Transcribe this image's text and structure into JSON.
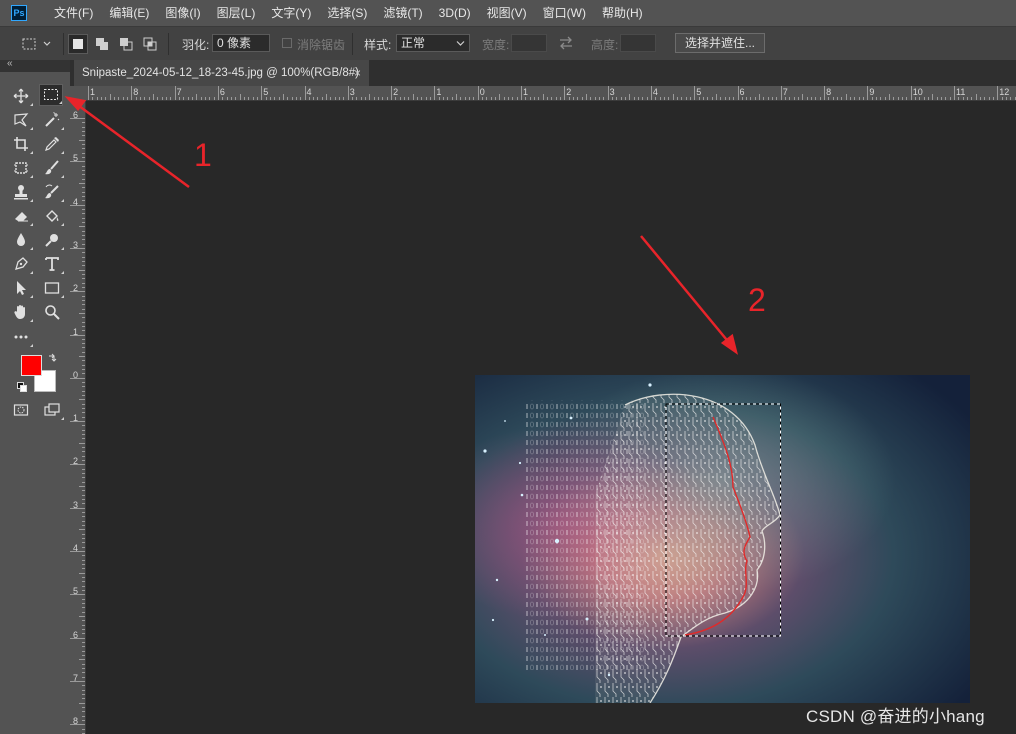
{
  "app": {
    "logo_text": "Ps"
  },
  "menu": [
    "文件(F)",
    "编辑(E)",
    "图像(I)",
    "图层(L)",
    "文字(Y)",
    "选择(S)",
    "滤镜(T)",
    "3D(D)",
    "视图(V)",
    "窗口(W)",
    "帮助(H)"
  ],
  "options_bar": {
    "feather_label": "羽化:",
    "feather_value": "0 像素",
    "antialias_label": "消除锯齿",
    "style_label": "样式:",
    "style_value": "正常",
    "width_label": "宽度:",
    "height_label": "高度:",
    "refine_button": "选择并遮住..."
  },
  "document": {
    "tab_title": "Snipaste_2024-05-12_18-23-45.jpg @ 100%(RGB/8#)",
    "close_glyph": "×"
  },
  "rulers": {
    "h_labels": [
      "1",
      "8",
      "7",
      "6",
      "5",
      "4",
      "3",
      "2",
      "1",
      "0",
      "1",
      "2",
      "3",
      "4",
      "5",
      "6",
      "7",
      "8",
      "9",
      "10",
      "11",
      "12"
    ],
    "v_labels": [
      "6",
      "5",
      "4",
      "3",
      "2",
      "1",
      "0",
      "1",
      "2",
      "3",
      "4",
      "5",
      "6",
      "7",
      "8"
    ]
  },
  "colors": {
    "foreground": "#ff0000",
    "background": "#ffffff",
    "annotation": "#e8242a"
  },
  "annotations": {
    "label_1": "1",
    "label_2": "2"
  },
  "watermark": "CSDN @奋进的小hang",
  "icons": [
    "move-icon",
    "marquee-icon",
    "lasso-icon",
    "magic-wand-icon",
    "crop-icon",
    "eyedropper-icon",
    "healing-icon",
    "brush-icon",
    "stamp-icon",
    "history-brush-icon",
    "eraser-icon",
    "bucket-icon",
    "blur-icon",
    "dodge-icon",
    "pen-icon",
    "type-icon",
    "path-select-icon",
    "rectangle-icon",
    "hand-icon",
    "zoom-icon",
    "more-icon",
    "swap-colors-icon",
    "default-colors-icon",
    "quick-mask-icon",
    "screen-mode-icon"
  ]
}
